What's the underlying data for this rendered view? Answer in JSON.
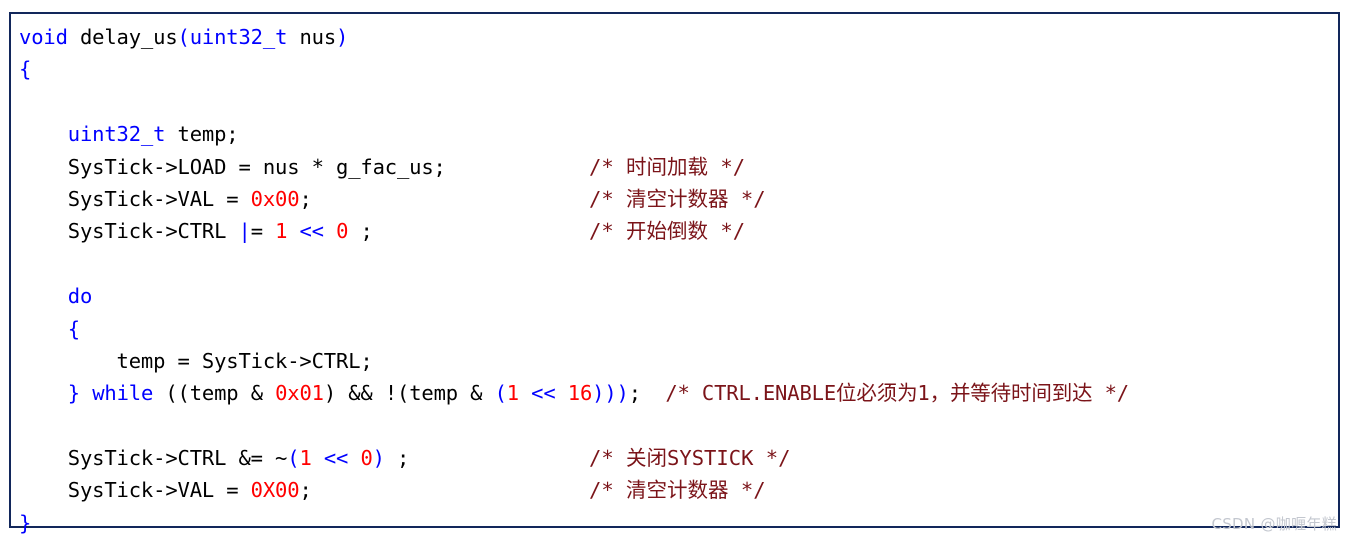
{
  "window": {
    "kind": "code-snippet-image",
    "background_color": "#ffffff",
    "frame_border_color": "#12275b"
  },
  "palette": {
    "keyword": "#0000ff",
    "punctuation": "#0000ff",
    "number": "#ff0000",
    "plain": "#000000",
    "comment": "#7b1419",
    "watermark": "#c3c7cf"
  },
  "code": {
    "language": "c",
    "function_name": "delay_us",
    "lines": [
      {
        "indent": "",
        "tokens": [
          {
            "t": "void",
            "c": "kw"
          },
          {
            "t": " delay_us",
            "c": "plain"
          },
          {
            "t": "(",
            "c": "pun"
          },
          {
            "t": "uint32_t",
            "c": "kw"
          },
          {
            "t": " nus",
            "c": "plain"
          },
          {
            "t": ")",
            "c": "pun"
          }
        ],
        "comment": ""
      },
      {
        "indent": "",
        "tokens": [
          {
            "t": "{",
            "c": "pun"
          }
        ],
        "comment": ""
      },
      {
        "indent": "",
        "tokens": [],
        "comment": ""
      },
      {
        "indent": "    ",
        "tokens": [
          {
            "t": "uint32_t",
            "c": "kw"
          },
          {
            "t": " temp;",
            "c": "plain"
          }
        ],
        "comment": ""
      },
      {
        "indent": "    ",
        "tokens": [
          {
            "t": "SysTick->LOAD = nus * g_fac_us;",
            "c": "plain"
          }
        ],
        "comment": "/* 时间加载 */"
      },
      {
        "indent": "    ",
        "tokens": [
          {
            "t": "SysTick->VAL = ",
            "c": "plain"
          },
          {
            "t": "0x00",
            "c": "num"
          },
          {
            "t": ";",
            "c": "plain"
          }
        ],
        "comment": "/* 清空计数器 */"
      },
      {
        "indent": "    ",
        "tokens": [
          {
            "t": "SysTick->CTRL ",
            "c": "plain"
          },
          {
            "t": "|",
            "c": "pun"
          },
          {
            "t": "= ",
            "c": "plain"
          },
          {
            "t": "1",
            "c": "num"
          },
          {
            "t": " << ",
            "c": "pun"
          },
          {
            "t": "0",
            "c": "num"
          },
          {
            "t": " ;",
            "c": "plain"
          }
        ],
        "comment": "/* 开始倒数 */"
      },
      {
        "indent": "",
        "tokens": [],
        "comment": ""
      },
      {
        "indent": "    ",
        "tokens": [
          {
            "t": "do",
            "c": "kw"
          }
        ],
        "comment": ""
      },
      {
        "indent": "    ",
        "tokens": [
          {
            "t": "{",
            "c": "pun"
          }
        ],
        "comment": ""
      },
      {
        "indent": "        ",
        "tokens": [
          {
            "t": "temp = SysTick->CTRL;",
            "c": "plain"
          }
        ],
        "comment": ""
      },
      {
        "indent": "    ",
        "tokens": [
          {
            "t": "}",
            "c": "pun"
          },
          {
            "t": " ",
            "c": "plain"
          },
          {
            "t": "while",
            "c": "kw"
          },
          {
            "t": " ((temp & ",
            "c": "plain"
          },
          {
            "t": "0x01",
            "c": "num"
          },
          {
            "t": ") && !(temp & ",
            "c": "plain"
          },
          {
            "t": "(",
            "c": "pun"
          },
          {
            "t": "1",
            "c": "num"
          },
          {
            "t": " << ",
            "c": "pun"
          },
          {
            "t": "16",
            "c": "num"
          },
          {
            "t": ")",
            "c": "pun"
          },
          {
            "t": ")",
            "c": "pun"
          },
          {
            "t": ")",
            "c": "pun"
          },
          {
            "t": ";  ",
            "c": "plain"
          },
          {
            "t": "/* CTRL.ENABLE位必须为1，并等待时间到达 */",
            "c": "cmt"
          }
        ],
        "comment": ""
      },
      {
        "indent": "",
        "tokens": [],
        "comment": ""
      },
      {
        "indent": "    ",
        "tokens": [
          {
            "t": "SysTick->CTRL &= ~",
            "c": "plain"
          },
          {
            "t": "(",
            "c": "pun"
          },
          {
            "t": "1",
            "c": "num"
          },
          {
            "t": " << ",
            "c": "pun"
          },
          {
            "t": "0",
            "c": "num"
          },
          {
            "t": ")",
            "c": "pun"
          },
          {
            "t": " ;",
            "c": "plain"
          }
        ],
        "comment": "/* 关闭SYSTICK */"
      },
      {
        "indent": "    ",
        "tokens": [
          {
            "t": "SysTick->VAL = ",
            "c": "plain"
          },
          {
            "t": "0X00",
            "c": "num"
          },
          {
            "t": ";",
            "c": "plain"
          }
        ],
        "comment": "/* 清空计数器 */"
      },
      {
        "indent": "",
        "tokens": [
          {
            "t": "}",
            "c": "pun"
          }
        ],
        "comment": ""
      }
    ]
  },
  "watermark": {
    "text": "CSDN @咖喱年糕"
  }
}
